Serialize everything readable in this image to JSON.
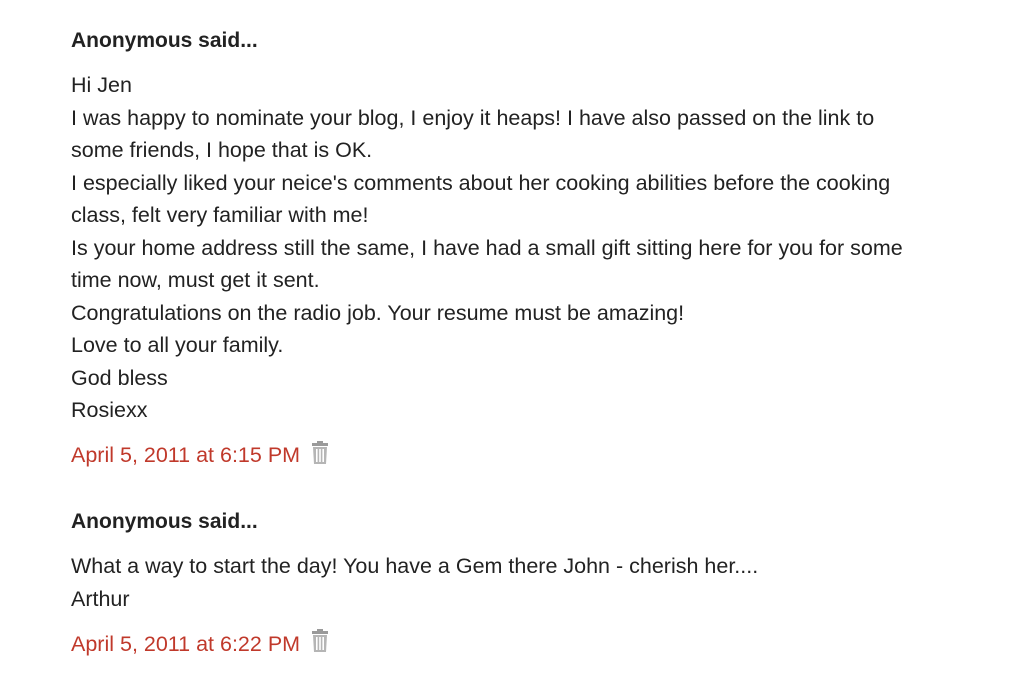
{
  "comments": [
    {
      "author": "Anonymous said...",
      "lines": [
        "Hi Jen",
        "I was happy to nominate your blog, I enjoy it heaps! I have also passed on the link to",
        "some friends, I hope that is OK.",
        "I especially liked your neice's comments about her cooking abilities before the cooking",
        "class, felt very familiar with me!",
        "Is your home address still the same, I have had a small gift sitting here for you for some",
        "time now, must get it sent.",
        "Congratulations on the radio job. Your resume must be amazing!",
        "Love to all your family.",
        "God bless",
        "Rosiexx"
      ],
      "timestamp": "April 5, 2011 at 6:15 PM",
      "delete_icon": "trash-icon"
    },
    {
      "author": "Anonymous said...",
      "lines": [
        "What a way to start the day! You have a Gem there John - cherish her....",
        "Arthur"
      ],
      "timestamp": "April 5, 2011 at 6:22 PM",
      "delete_icon": "trash-icon"
    }
  ],
  "colors": {
    "text": "#222222",
    "link": "#c0392b",
    "icon": "#9a9a9a"
  }
}
